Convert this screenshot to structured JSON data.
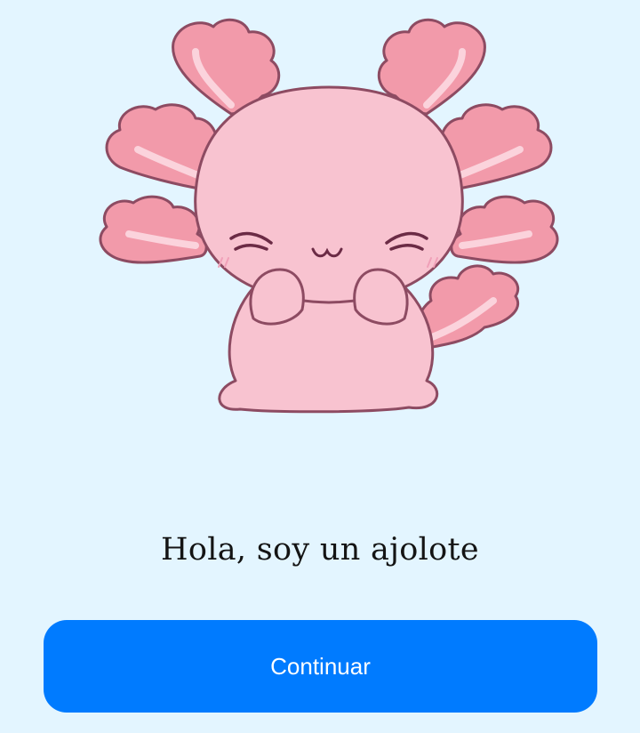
{
  "illustration": {
    "subject": "axolotl-mascot",
    "colors": {
      "body": "#f8c3d0",
      "gills": "#f29aaa",
      "gill_inner": "#fbd3dc",
      "outline": "#8d4b62",
      "face": "#6b2b45",
      "blush": "#f0a0b8"
    }
  },
  "greeting": {
    "text": "Hola, soy un ajolote"
  },
  "continue_button": {
    "label": "Continuar",
    "color": "#007bff"
  },
  "page": {
    "background": "#e3f5ff"
  }
}
